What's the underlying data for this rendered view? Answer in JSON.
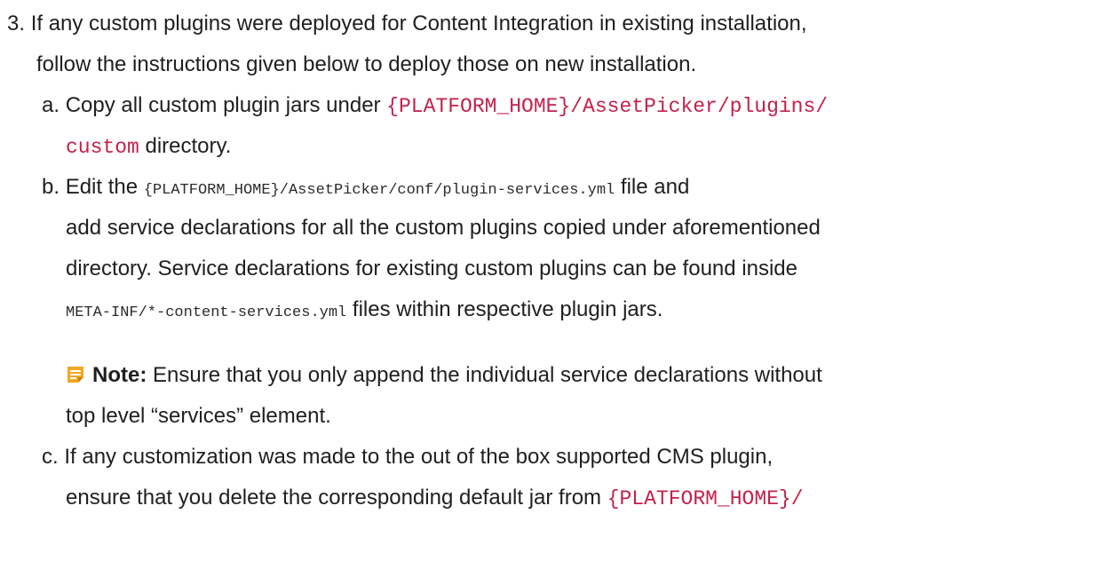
{
  "step3": {
    "number": "3.",
    "line1": "If any custom plugins were deployed for Content Integration in existing installation,",
    "line2": "follow the instructions given below to deploy those on new installation."
  },
  "step_a": {
    "letter": "a.",
    "text_before": "Copy all custom plugin jars under ",
    "path_part1": "{PLATFORM_HOME}/AssetPicker/plugins/",
    "path_part2": "custom",
    "text_after": " directory."
  },
  "step_b": {
    "letter": "b.",
    "text_before": "Edit the ",
    "path": "{PLATFORM_HOME}/AssetPicker/conf/plugin-services.yml",
    "text_after": "  file and",
    "line2": "add service declarations for all the custom plugins copied under aforementioned",
    "line3": "directory. Service declarations for existing custom plugins can be found inside",
    "meta_path": "META-INF/*-content-services.yml",
    "line4_after": " files within respective plugin jars."
  },
  "note": {
    "icon": "note-icon",
    "label": "Note:",
    "line1": "  Ensure that you only append the individual service declarations without",
    "line2": "top level “services” element."
  },
  "step_c": {
    "letter": "c.",
    "line1": "If any customization was made to the out of the box supported CMS plugin,",
    "line2_before": "ensure that you delete the corresponding default jar from ",
    "line2_path": "{PLATFORM_HOME}/"
  },
  "colors": {
    "text": "#1f1f1f",
    "code_accent": "#c4214d",
    "note_icon": "#f5a623"
  }
}
